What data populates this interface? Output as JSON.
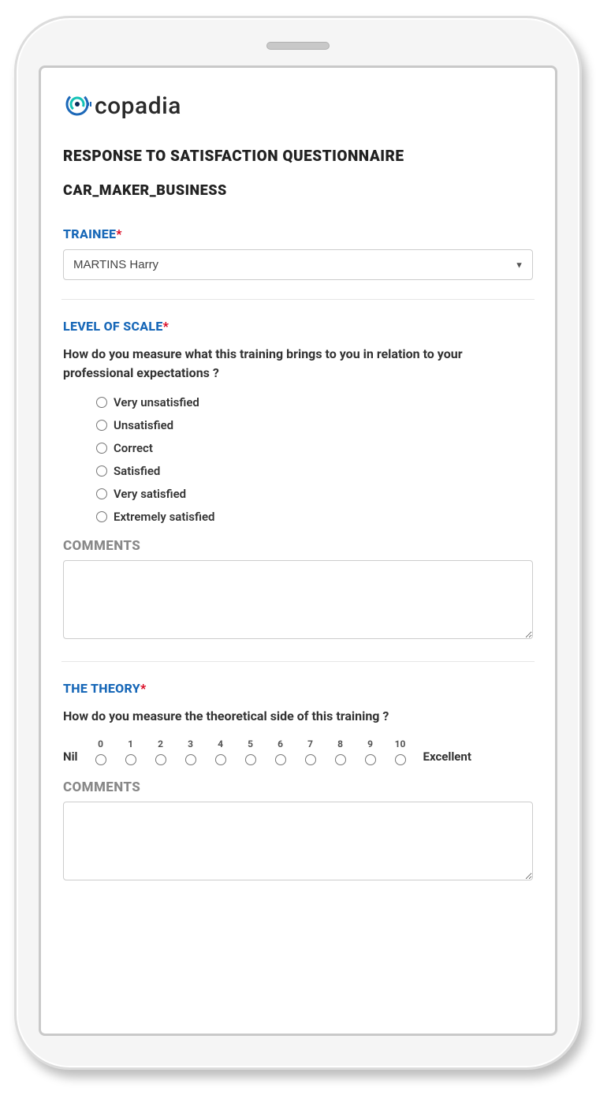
{
  "logo_text": "copadia",
  "page_title": "RESPONSE TO SATISFACTION QUESTIONNAIRE",
  "subtitle": "CAR_MAKER_BUSINESS",
  "trainee": {
    "label": "TRAINEE",
    "selected": "MARTINS Harry"
  },
  "level_of_scale": {
    "label": "LEVEL OF SCALE",
    "question": "How do you measure what this training brings to you in relation to your professional expectations ?",
    "options": [
      "Very unsatisfied",
      "Unsatisfied",
      "Correct",
      "Satisfied",
      "Very satisfied",
      "Extremely satisfied"
    ],
    "comments_label": "COMMENTS"
  },
  "theory": {
    "label": "THE THEORY",
    "question": "How do you measure the theoretical side of this training ?",
    "scale_min_label": "Nil",
    "scale_max_label": "Excellent",
    "scale_values": [
      "0",
      "1",
      "2",
      "3",
      "4",
      "5",
      "6",
      "7",
      "8",
      "9",
      "10"
    ],
    "comments_label": "COMMENTS"
  },
  "required_marker": "*"
}
